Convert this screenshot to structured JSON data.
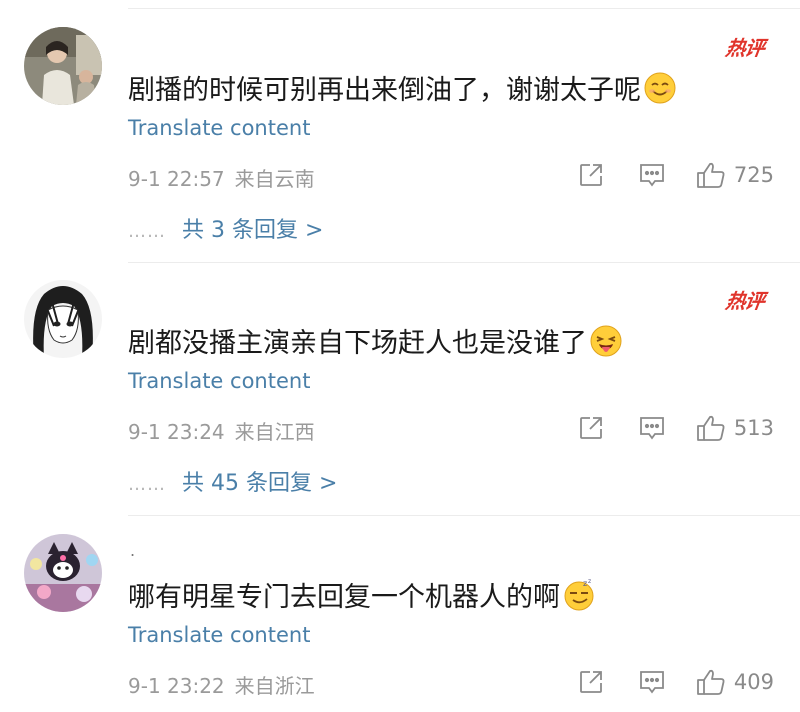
{
  "colors": {
    "hot_badge": "#e0342b",
    "link": "#4a7fa8",
    "meta": "#9a9a9a",
    "text": "#1a1a1a"
  },
  "comments": [
    {
      "hot_label": "热评",
      "text": "剧播的时候可别再出来倒油了，谢谢太子呢",
      "emoji": "smiling-face-icon",
      "translate": "Translate content",
      "time": "9-1 22:57",
      "location": "来自云南",
      "likes": "725",
      "dots": "……",
      "replies": "共 3 条回复 >"
    },
    {
      "hot_label": "热评",
      "text": "剧都没播主演亲自下场赶人也是没谁了",
      "emoji": "tongue-out-face-icon",
      "translate": "Translate content",
      "time": "9-1 23:24",
      "location": "来自江西",
      "likes": "513",
      "dots": "……",
      "replies": "共 45 条回复 >"
    },
    {
      "name": ".",
      "text": "哪有明星专门去回复一个机器人的啊",
      "emoji": "sleepy-smirk-face-icon",
      "translate": "Translate content",
      "time": "9-1 23:22",
      "location": "来自浙江",
      "likes": "409"
    }
  ]
}
